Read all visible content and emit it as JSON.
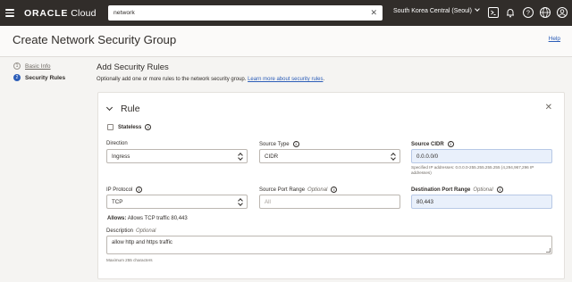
{
  "topbar": {
    "brand_bold": "ORACLE",
    "brand_rest": " Cloud",
    "search_value": "network",
    "region": "South Korea Central (Seoul)",
    "icons": [
      "hamburger-icon",
      "cloud-shell-icon",
      "bell-icon",
      "help-icon",
      "globe-icon",
      "user-icon"
    ]
  },
  "header": {
    "title": "Create Network Security Group",
    "help": "Help"
  },
  "steps": [
    {
      "num": "1",
      "label": "Basic Info"
    },
    {
      "num": "2",
      "label": "Security Rules"
    }
  ],
  "section": {
    "title": "Add Security Rules",
    "desc": "Optionally add one or more rules to the network security group.",
    "link": "Learn more about security rules",
    "period": "."
  },
  "rule": {
    "title": "Rule",
    "stateless": "Stateless",
    "direction": {
      "label": "Direction",
      "value": "Ingress"
    },
    "source_type": {
      "label": "Source Type",
      "value": "CIDR"
    },
    "source_cidr": {
      "label": "Source CIDR",
      "value": "0.0.0.0/0",
      "hint": "Specified IP addresses: 0.0.0.0-255.255.255.255 (4,294,967,296 IP addresses)"
    },
    "ip_protocol": {
      "label": "IP Protocol",
      "value": "TCP"
    },
    "source_port": {
      "label": "Source Port Range",
      "optional": "Optional",
      "placeholder": "All"
    },
    "dest_port": {
      "label": "Destination Port Range",
      "optional": "Optional",
      "value": "80,443"
    },
    "allows_label": "Allows:",
    "allows_text": "Allows TCP traffic 80,443",
    "description": {
      "label": "Description",
      "optional": "Optional",
      "value": "allow http and https traffic",
      "hint": "Maximum 255 characters"
    }
  },
  "colors": {
    "accent": "#2c5db8",
    "topbar": "#312d2a",
    "field_selected": "#e9f0fb"
  }
}
